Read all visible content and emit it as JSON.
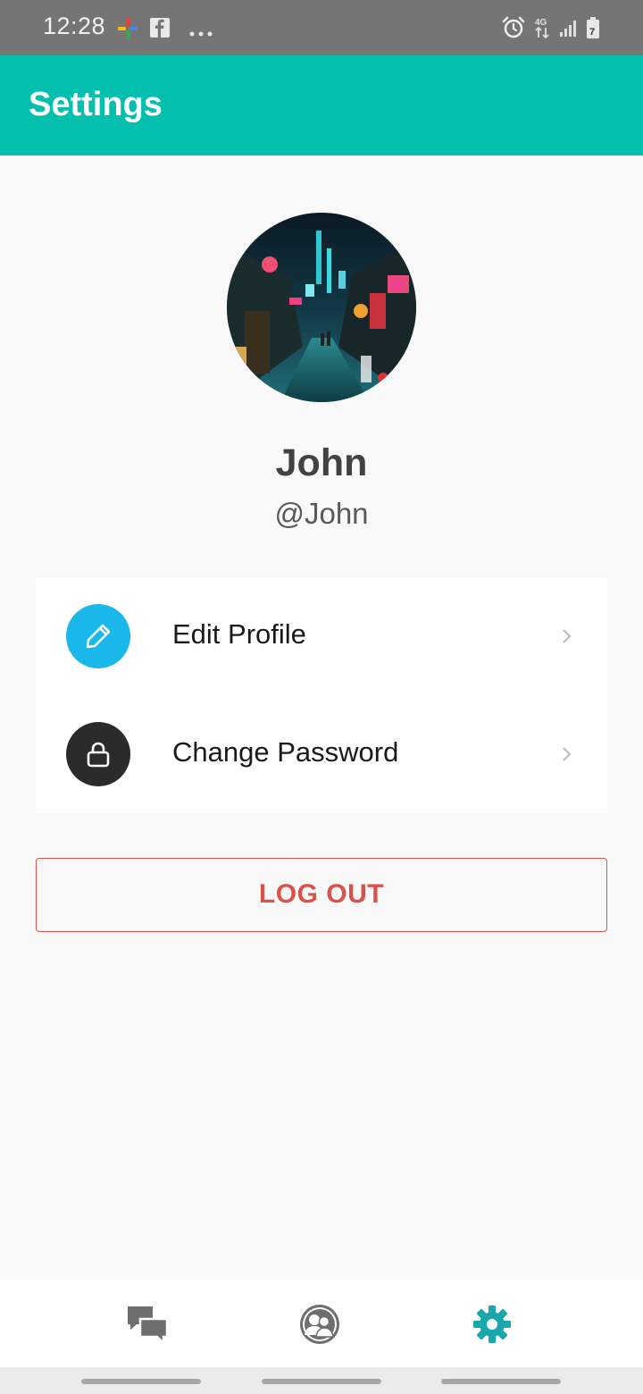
{
  "status_bar": {
    "time": "12:28",
    "left_icons": [
      "photos-pinwheel-icon",
      "facebook-icon",
      "more-dots-icon"
    ],
    "right_icons": [
      "alarm-icon",
      "4g-data-icon",
      "signal-icon",
      "battery-icon"
    ],
    "battery_level": "7"
  },
  "app_bar": {
    "title": "Settings",
    "color": "#03bfae"
  },
  "profile": {
    "name": "John",
    "handle": "@John",
    "avatar": "night-street-photo"
  },
  "menu": {
    "items": [
      {
        "label": "Edit Profile",
        "icon": "pencil-icon",
        "color": "#1ab7ea"
      },
      {
        "label": "Change Password",
        "icon": "lock-icon",
        "color": "#2b2b2b"
      }
    ]
  },
  "logout": {
    "label": "LOG OUT",
    "color": "#d9534a"
  },
  "bottom_nav": {
    "items": [
      {
        "icon": "chat-bubbles-icon",
        "active": false
      },
      {
        "icon": "contacts-icon",
        "active": false
      },
      {
        "icon": "gear-icon",
        "active": true
      }
    ],
    "active_color": "#17a7ad",
    "inactive_color": "#6e6e6e"
  }
}
